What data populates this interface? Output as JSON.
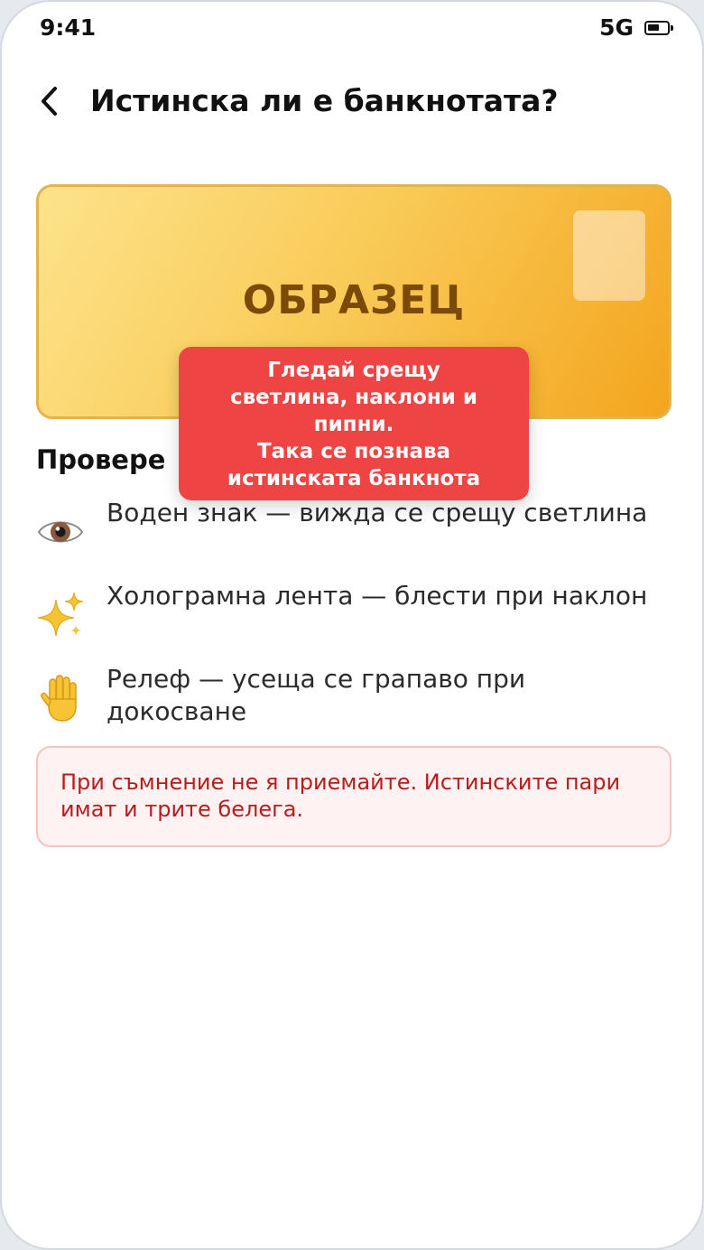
{
  "status_bar": {
    "time": "9:41",
    "network": "5G"
  },
  "header": {
    "title": "Истинска ли е банкнотата?"
  },
  "banknote": {
    "label": "ОБРАЗЕЦ"
  },
  "tooltip": {
    "lines": [
      "Гледай срещу",
      "светлина, наклони и",
      "пипни.",
      "Така се познава",
      "истинската банкнота"
    ]
  },
  "checks": {
    "title": "Провере",
    "items": [
      {
        "icon": "eye-icon",
        "text": "Воден знак — вижда се срещу светлина"
      },
      {
        "icon": "sparkles-icon",
        "text": "Холограмна лента — блести при наклон"
      },
      {
        "icon": "raised-hand-icon",
        "text": "Релеф — усеща се грапаво при докосване"
      }
    ]
  },
  "warning": {
    "text": "При съмнение не я приемайте. Истинските пари имат и трите белега."
  },
  "colors": {
    "tooltip_bg": "#ef4444",
    "banknote_text": "#7a4a06",
    "warning_text": "#b91c1c",
    "warning_bg": "#fef2f2"
  }
}
